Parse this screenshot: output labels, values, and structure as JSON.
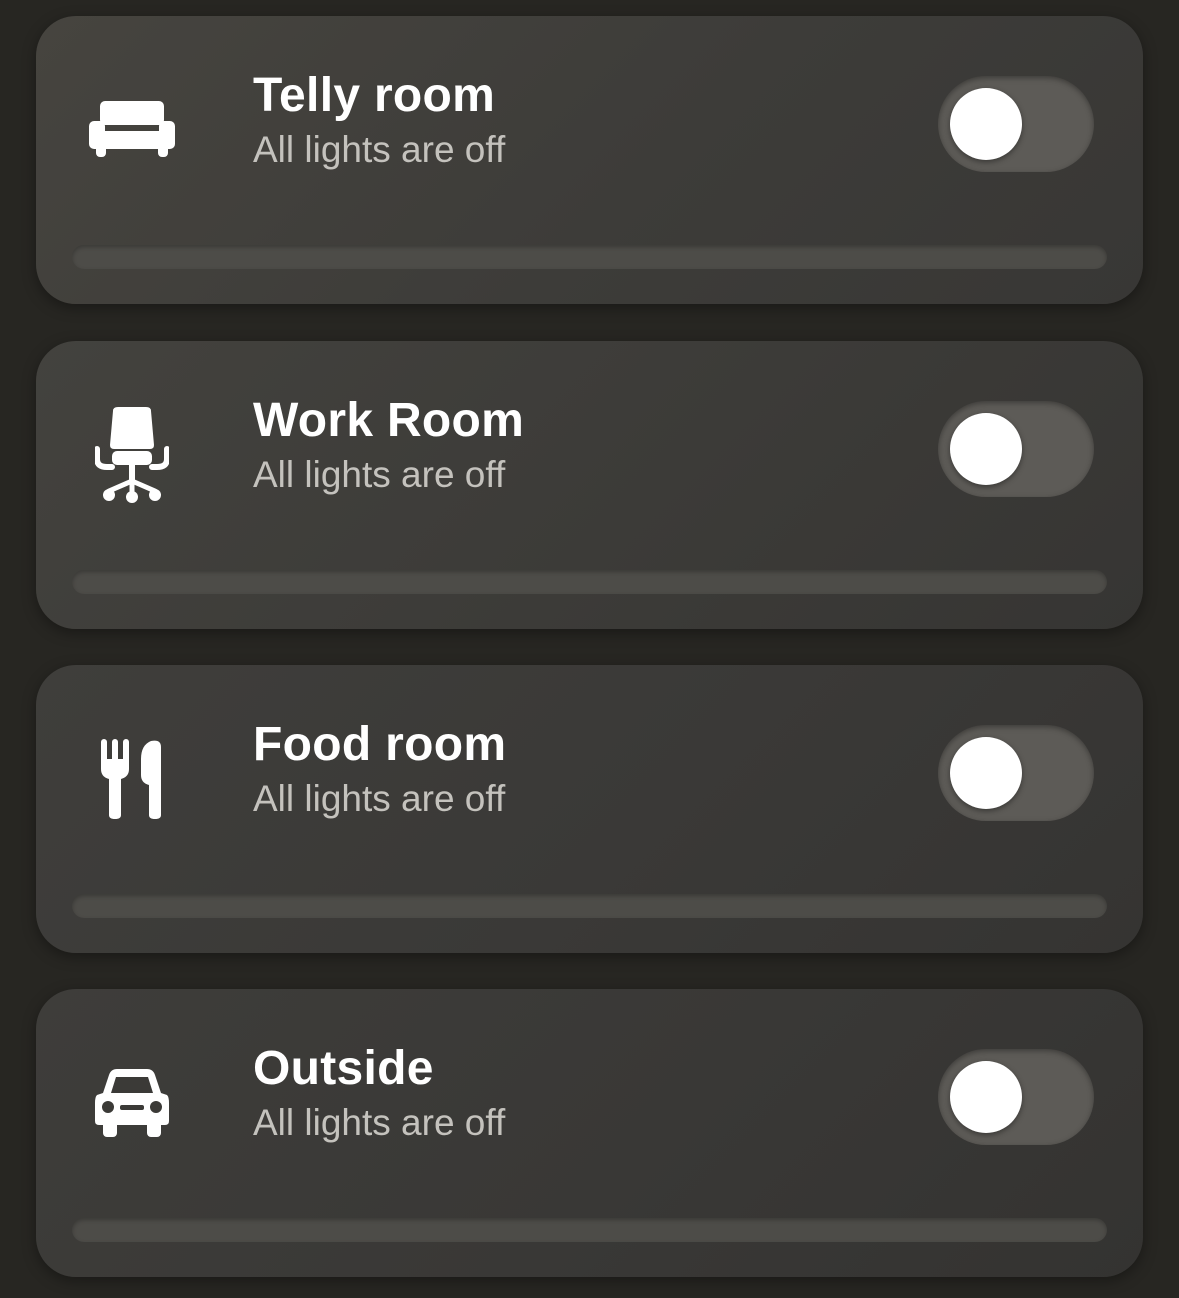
{
  "rooms": [
    {
      "name": "Telly room",
      "status": "All lights are off",
      "icon": "sofa-icon",
      "on": false,
      "brightness": 0
    },
    {
      "name": "Work Room",
      "status": "All lights are off",
      "icon": "office-chair-icon",
      "on": false,
      "brightness": 0
    },
    {
      "name": "Food room",
      "status": "All lights are off",
      "icon": "fork-knife-icon",
      "on": false,
      "brightness": 0
    },
    {
      "name": "Outside",
      "status": "All lights are off",
      "icon": "car-icon",
      "on": false,
      "brightness": 0
    }
  ],
  "colors": {
    "background": "#272622",
    "card": "#3d3c39",
    "toggle_off": "#5d5b57",
    "title": "#ffffff",
    "subtitle": "#c4c2bd"
  }
}
